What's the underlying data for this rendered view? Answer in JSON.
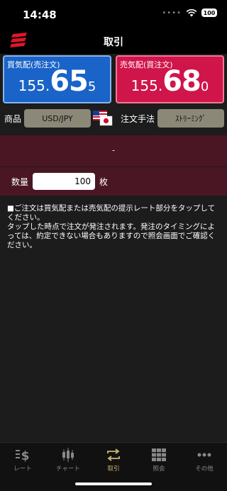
{
  "status_bar": {
    "time": "14:48",
    "battery": "100"
  },
  "header": {
    "title": "取引"
  },
  "buy_panel": {
    "label": "買気配(売注文)",
    "price_small": "155.",
    "price_big": "65",
    "price_tail": "5"
  },
  "sell_panel": {
    "label": "売気配(買注文)",
    "price_small": "155.",
    "price_big": "68",
    "price_tail": "0"
  },
  "product": {
    "label": "商品",
    "value": "USD/JPY"
  },
  "order_method": {
    "label": "注文手法",
    "value": "ｽﾄﾘｰﾐﾝｸﾞ"
  },
  "spread_display": "-",
  "quantity": {
    "label": "数量",
    "value": "100",
    "unit": "枚"
  },
  "notice_text": "■ご注文は買気配または売気配の提示レート部分をタップしてください。\nタップした時点で注文が発注されます。発注のタイミングによっては、約定できない場合もありますので照会画面でご確認ください。",
  "tabs": [
    {
      "label": "レート",
      "icon": "yen-rate-icon"
    },
    {
      "label": "チャート",
      "icon": "candlestick-chart-icon"
    },
    {
      "label": "取引",
      "icon": "exchange-arrows-icon",
      "active": true
    },
    {
      "label": "照会",
      "icon": "grid-icon"
    },
    {
      "label": "その他",
      "icon": "more-dots-icon"
    }
  ],
  "colors": {
    "buy": "#1a63c8",
    "sell": "#d0154b",
    "band": "#4a1624",
    "active_tab": "#c8b86e"
  }
}
